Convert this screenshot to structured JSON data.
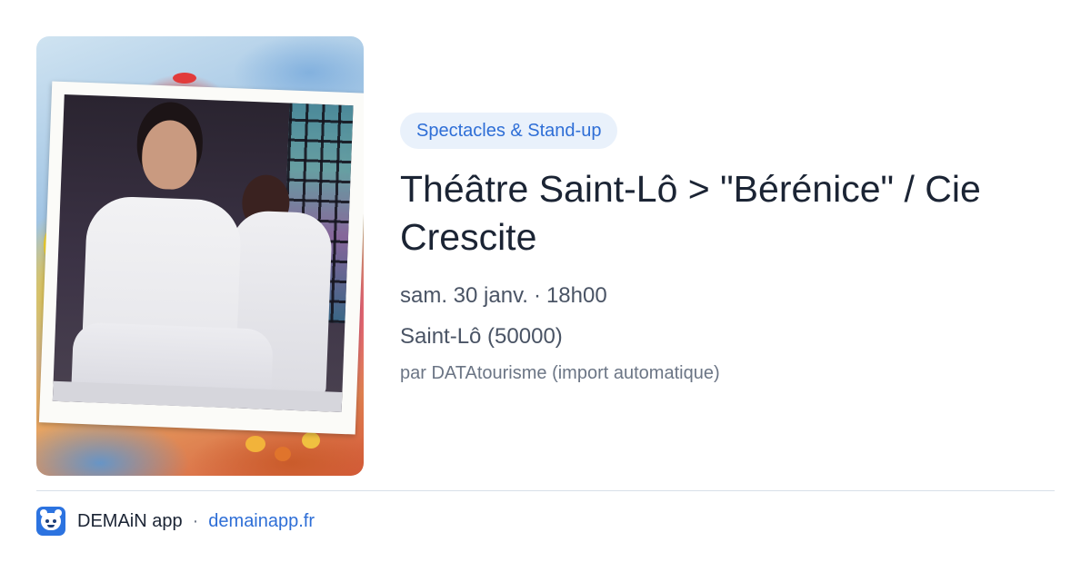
{
  "event": {
    "category": "Spectacles & Stand-up",
    "title": "Théâtre Saint-Lô > \"Bérénice\" / Cie Crescite",
    "date": "sam. 30 janv.",
    "time": "18h00",
    "date_time_separator": "·",
    "location": "Saint-Lô (50000)",
    "source": "par DATAtourisme (import automatique)"
  },
  "footer": {
    "app_name": "DEMAiN app",
    "separator": "·",
    "domain": "demainapp.fr",
    "icon": "bear-face-icon"
  },
  "colors": {
    "accent": "#2e6ed6",
    "pill_background": "#e9f1fb",
    "title_text": "#1b2434",
    "meta_text": "#4a5465"
  }
}
